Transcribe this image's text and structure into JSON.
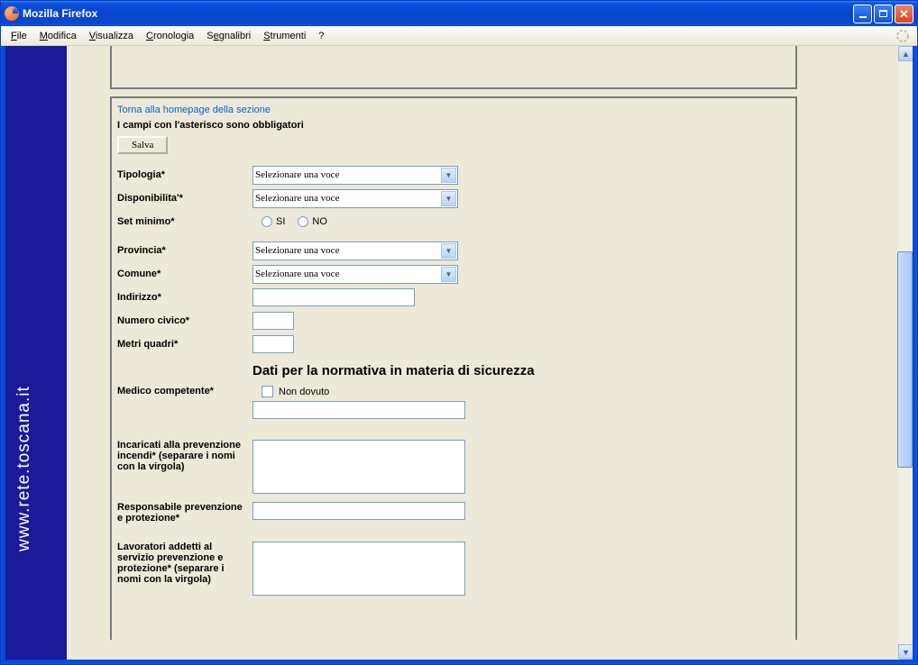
{
  "window": {
    "title": "Mozilla Firefox"
  },
  "menu": {
    "file": "File",
    "modifica": "Modifica",
    "visualizza": "Visualizza",
    "cronologia": "Cronologia",
    "segnalibri": "Segnalibri",
    "strumenti": "Strumenti",
    "help": "?"
  },
  "sidebar": {
    "url_text": "www.rete.toscana.it"
  },
  "form": {
    "back_link": "Torna alla homepage della sezione",
    "required_note": "I campi con l'asterisco sono obbligatori",
    "save_label": "Salva",
    "select_placeholder": "Selezionare una voce",
    "labels": {
      "tipologia": "Tipologia*",
      "disponibilita": "Disponibilita'*",
      "set_minimo": "Set minimo*",
      "provincia": "Provincia*",
      "comune": "Comune*",
      "indirizzo": "Indirizzo*",
      "numero_civico": "Numero civico*",
      "metri_quadri": "Metri quadri*",
      "medico": "Medico competente*",
      "incaricati": "Incaricati alla prevenzione incendi* (separare i nomi con la virgola)",
      "responsabile": "Responsabile prevenzione e protezione*",
      "lavoratori": "Lavoratori addetti al servizio prevenzione e protezione* (separare i nomi con la virgola)"
    },
    "radio": {
      "si": "SI",
      "no": "NO"
    },
    "section_heading": "Dati per la normativa in materia di sicurezza",
    "checkbox_label": "Non dovuto"
  }
}
